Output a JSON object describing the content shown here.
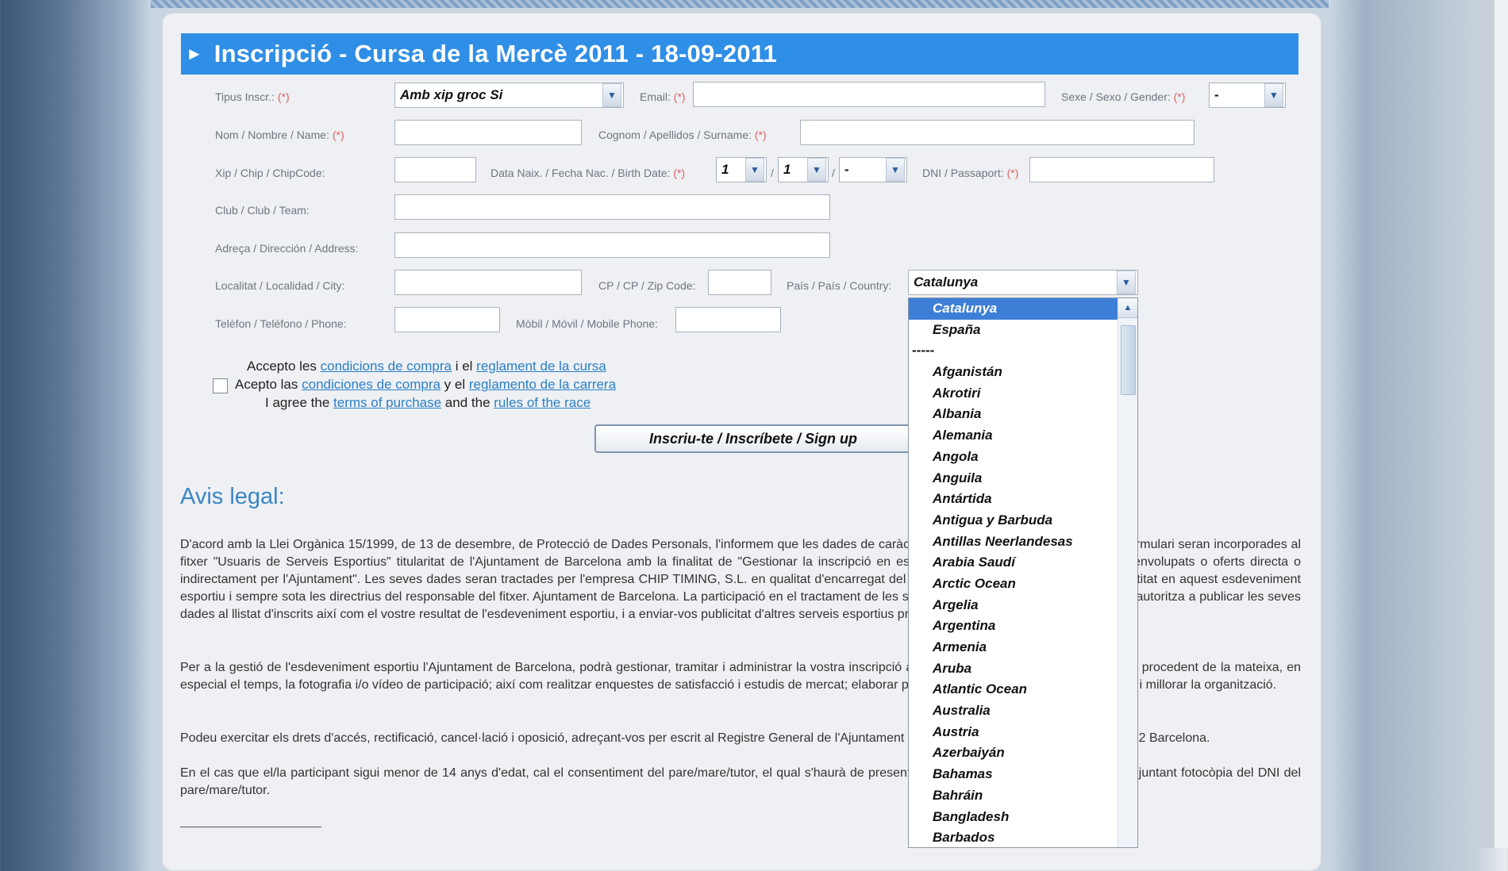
{
  "form": {
    "title": "Inscripció - Cursa de la Mercè 2011 - 18-09-2011",
    "req_mark": "(*)",
    "tipus_label": "Tipus Inscr.:",
    "tipus_value": "Amb xip groc Si",
    "email_label": "Email:",
    "sexo_label": "Sexe / Sexo / Gender:",
    "sexo_value": "-",
    "nom_label": "Nom / Nombre / Name:",
    "cognom_label": "Cognom / Apellidos / Surname:",
    "xip_label": "Xip / Chip / ChipCode:",
    "naix_label": "Data Naix. / Fecha Nac. / Birth Date:",
    "day_value": "1",
    "month_value": "1",
    "year_value": "-",
    "date_sep": "/",
    "dni_label": "DNI / Passaport:",
    "club_label": "Club / Club / Team:",
    "adreca_label": "Adreça / Dirección / Address:",
    "localitat_label": "Localitat / Localidad / City:",
    "cp_label": "CP / CP / Zip Code:",
    "pais_label": "País / País / Country:",
    "pais_value": "Catalunya",
    "telefon_label": "Telèfon / Teléfono / Phone:",
    "mobil_label": "Mòbil / Móvil / Mobile Phone:",
    "submit_label": "Inscriu-te / Inscríbete / Sign up"
  },
  "agreement": {
    "l1_pre": "Accepto les ",
    "l1_link1": "condicions de compra",
    "l1_mid": " i el ",
    "l1_link2": "reglament de la cursa",
    "l2_pre": "Acepto las ",
    "l2_link1": "condiciones de compra",
    "l2_mid": " y el ",
    "l2_link2": "reglamento de la carrera",
    "l3_pre": "I agree the ",
    "l3_link1": "terms of purchase",
    "l3_mid": " and the ",
    "l3_link2": "rules of the race"
  },
  "legal": {
    "heading": "Avis legal:",
    "p1": "D'acord amb la Llei Orgànica 15/1999, de 13 de desembre, de Protecció de Dades Personals, l'informem que les dades de caràcter personal que ens faciliti en aquest formulari seran incorporades al fitxer \"Usuaris de Serveis Esportius\" titularitat de l'Ajuntament de Barcelona amb la finalitat de \"Gestionar la inscripció en esdeveniments esportius promoguts, desenvolupats o oferts directa o indirectament per l'Ajuntament\". Les seves dades seran tractades per l'empresa CHIP TIMING, S.L. en qualitat d'encarregat del tractament per a la gestió pròpia de l'entitat en aquest esdeveniment esportiu i sempre sota les directrius del responsable del fitxer. Ajuntament de Barcelona. La participació en el tractament de les seves dades per la finalitat indicada, ens autoritza a publicar les seves dades al llistat d'inscrits així com el vostre resultat de l'esdeveniment esportiu, i a enviar-vos publicitat d'altres serveis esportius promoguts per l'Ajuntament de Barcelona.",
    "p2": "Per a la gestió de l'esdeveniment esportiu l'Ajuntament de Barcelona, podrà gestionar, tramitar i administrar la vostra inscripció a l'esdeveniment; gestionar la informació procedent de la mateixa, en especial el temps, la fotografia i/o vídeo de participació; així com realitzar enquestes de satisfacció i estudis de mercat; elaborar perfils de participants a fi de personalitzar i millorar la organització.",
    "p3": "Podeu exercitar els drets d'accés, rectificació, cancel·lació i oposició, adreçant-vos per escrit al Registre General de l'Ajuntament de Barcelona, Plaça Sant Jaume 1, 08002 Barcelona.",
    "p4": "En el cas que el/la participant sigui menor de 14 anys d'edat, cal el consentiment del pare/mare/tutor, el qual s'haurà de presentar en el moment de recollir el dorsal, adjuntant fotocòpia del DNI del pare/mare/tutor."
  },
  "country_dropdown": {
    "options": [
      "Catalunya",
      "España",
      "-----",
      "Afganistán",
      "Akrotiri",
      "Albania",
      "Alemania",
      "Angola",
      "Anguila",
      "Antártida",
      "Antigua y Barbuda",
      "Antillas Neerlandesas",
      "Arabia Saudí",
      "Arctic Ocean",
      "Argelia",
      "Argentina",
      "Armenia",
      "Aruba",
      "Atlantic Ocean",
      "Australia",
      "Austria",
      "Azerbaiyán",
      "Bahamas",
      "Bahráin",
      "Bangladesh",
      "Barbados"
    ],
    "selected": "Catalunya"
  },
  "colors": {
    "title_bar": "#2f8ee6",
    "link": "#2a7fc7",
    "selected_option": "#3d7fd6",
    "heading": "#3c85c6"
  },
  "icons": {
    "title_arrow": "play-arrow-icon",
    "select_arrow": "chevron-down-icon",
    "scroll_up": "chevron-up-icon"
  }
}
